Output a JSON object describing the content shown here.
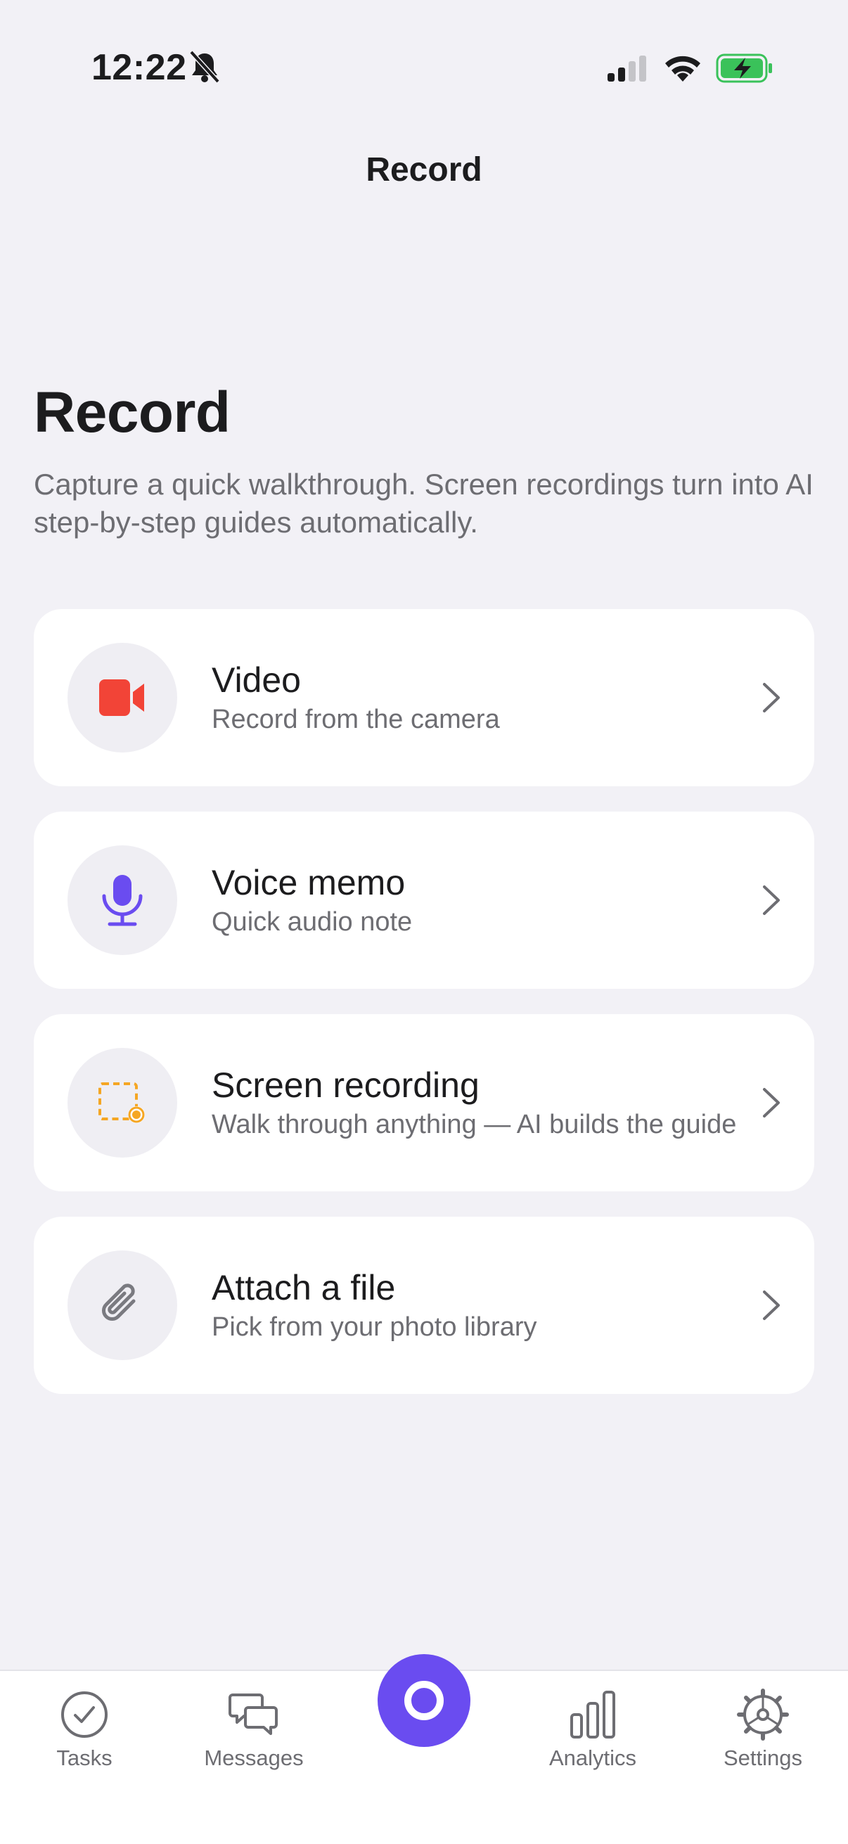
{
  "status_bar": {
    "time": "12:22",
    "icons": [
      "bell-slash-icon",
      "cellular-signal-icon",
      "wifi-icon",
      "battery-charging-icon"
    ]
  },
  "nav": {
    "title": "Record"
  },
  "header": {
    "title": "Record",
    "subtitle": "Capture a quick walkthrough. Screen recordings turn into AI step-by-step guides automatically."
  },
  "options": [
    {
      "title": "Video",
      "subtitle": "Record from the camera",
      "icon": "video-camera-icon",
      "color": "#f24437"
    },
    {
      "title": "Voice memo",
      "subtitle": "Quick audio note",
      "icon": "microphone-icon",
      "color": "#6a4cf0"
    },
    {
      "title": "Screen recording",
      "subtitle": "Walk through anything — AI builds the guide",
      "icon": "screen-record-icon",
      "color": "#f5a623"
    },
    {
      "title": "Attach a file",
      "subtitle": "Pick from your photo library",
      "icon": "paperclip-icon",
      "color": "#7a7a80"
    }
  ],
  "tab_bar": {
    "tabs": [
      {
        "label": "Tasks",
        "icon": "checkmark-circle-icon"
      },
      {
        "label": "Messages",
        "icon": "chat-bubbles-icon"
      },
      {
        "label": "",
        "icon": "record-icon"
      },
      {
        "label": "Analytics",
        "icon": "bar-chart-icon"
      },
      {
        "label": "Settings",
        "icon": "gear-icon"
      }
    ],
    "accent": "#6a4cf0"
  }
}
